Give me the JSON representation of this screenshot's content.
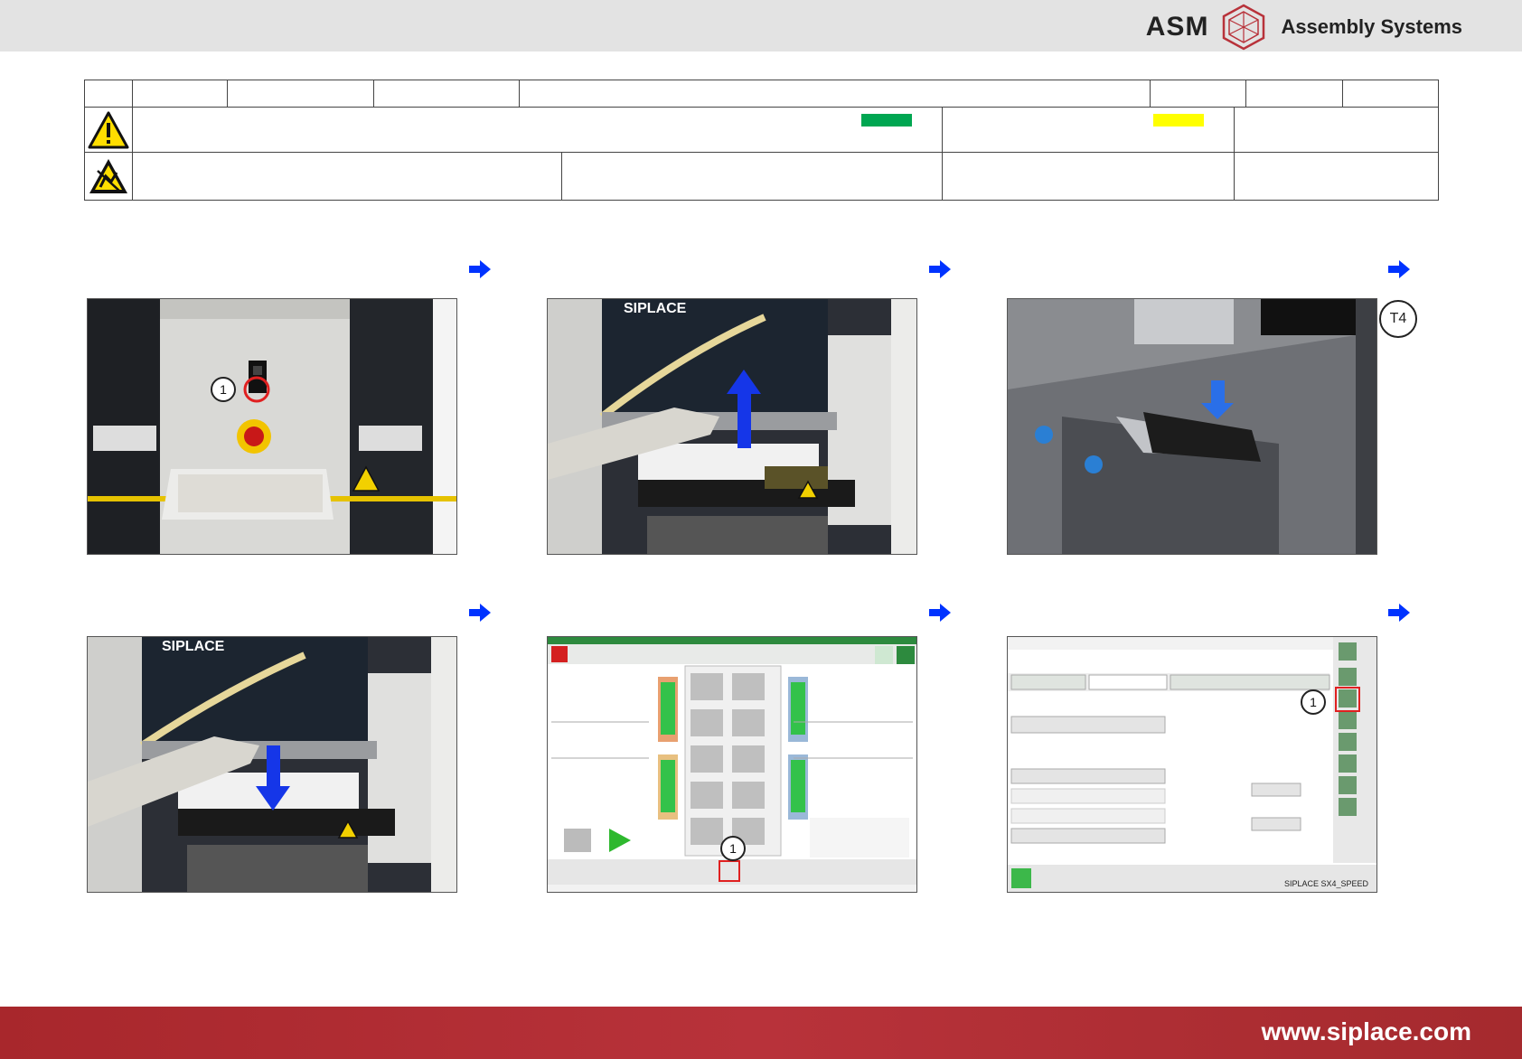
{
  "header": {
    "logo_asm": "ASM",
    "logo_tagline": "Assembly Systems"
  },
  "colors": {
    "status_green": "#00a651",
    "status_yellow": "#ffff00",
    "footer_red": "#b0282e",
    "arrow_blue": "#0033ff"
  },
  "icons": [
    "warning-triangle-icon",
    "esd-icon",
    "blue-arrow-right-icon"
  ],
  "steps": [
    {
      "callout": "1"
    },
    {
      "overlay_text": "SIPLACE"
    },
    {
      "tag": "T4"
    },
    {
      "overlay_text": "SIPLACE"
    },
    {
      "callout": "1"
    },
    {
      "callout": "1",
      "status_text": "SIPLACE SX4_SPEED"
    }
  ],
  "footer": {
    "url": "www.siplace.com"
  }
}
